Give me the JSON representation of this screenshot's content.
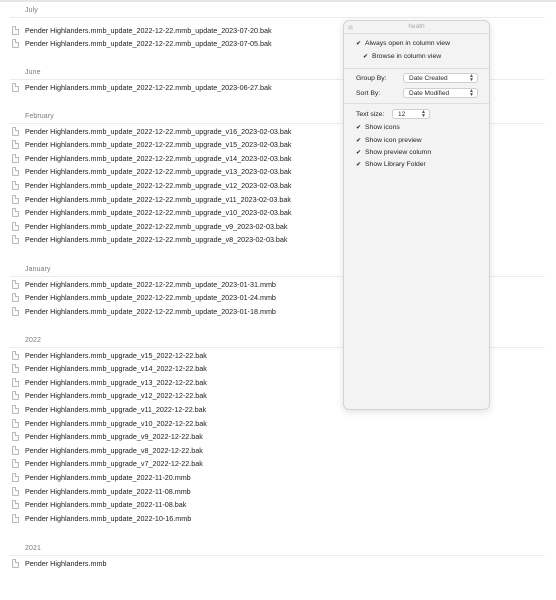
{
  "groups": [
    {
      "header": "July",
      "files": [
        "Pender Highlanders.mmb_update_2022-12-22.mmb_update_2023-07-20.bak",
        "Pender Highlanders.mmb_update_2022-12-22.mmb_update_2023-07-05.bak"
      ]
    },
    {
      "header": "June",
      "files": [
        "Pender Highlanders.mmb_update_2022-12-22.mmb_update_2023-06-27.bak"
      ]
    },
    {
      "header": "February",
      "files": [
        "Pender Highlanders.mmb_update_2022-12-22.mmb_upgrade_v16_2023-02-03.bak",
        "Pender Highlanders.mmb_update_2022-12-22.mmb_upgrade_v15_2023-02-03.bak",
        "Pender Highlanders.mmb_update_2022-12-22.mmb_upgrade_v14_2023-02-03.bak",
        "Pender Highlanders.mmb_update_2022-12-22.mmb_upgrade_v13_2023-02-03.bak",
        "Pender Highlanders.mmb_update_2022-12-22.mmb_upgrade_v12_2023-02-03.bak",
        "Pender Highlanders.mmb_update_2022-12-22.mmb_upgrade_v11_2023-02-03.bak",
        "Pender Highlanders.mmb_update_2022-12-22.mmb_upgrade_v10_2023-02-03.bak",
        "Pender Highlanders.mmb_update_2022-12-22.mmb_upgrade_v9_2023-02-03.bak",
        "Pender Highlanders.mmb_update_2022-12-22.mmb_upgrade_v8_2023-02-03.bak"
      ]
    },
    {
      "header": "January",
      "files": [
        "Pender Highlanders.mmb_update_2022-12-22.mmb_update_2023-01-31.mmb",
        "Pender Highlanders.mmb_update_2022-12-22.mmb_update_2023-01-24.mmb",
        "Pender Highlanders.mmb_update_2022-12-22.mmb_update_2023-01-18.mmb"
      ]
    },
    {
      "header": "2022",
      "files": [
        "Pender Highlanders.mmb_upgrade_v15_2022-12-22.bak",
        "Pender Highlanders.mmb_upgrade_v14_2022-12-22.bak",
        "Pender Highlanders.mmb_upgrade_v13_2022-12-22.bak",
        "Pender Highlanders.mmb_upgrade_v12_2022-12-22.bak",
        "Pender Highlanders.mmb_upgrade_v11_2022-12-22.bak",
        "Pender Highlanders.mmb_upgrade_v10_2022-12-22.bak",
        "Pender Highlanders.mmb_upgrade_v9_2022-12-22.bak",
        "Pender Highlanders.mmb_upgrade_v8_2022-12-22.bak",
        "Pender Highlanders.mmb_upgrade_v7_2022-12-22.bak",
        "Pender Highlanders.mmb_update_2022-11-20.mmb",
        "Pender Highlanders.mmb_update_2022-11-08.mmb",
        "Pender Highlanders.mmb_update_2022-11-08.bak",
        "Pender Highlanders.mmb_update_2022-10-16.mmb"
      ]
    },
    {
      "header": "2021",
      "files": [
        "Pender Highlanders.mmb"
      ]
    }
  ],
  "view_options": {
    "title": "heath",
    "always_open_column_view": {
      "label": "Always open in column view",
      "checked": true
    },
    "browse_column_view": {
      "label": "Browse in column view",
      "checked": true
    },
    "group_by": {
      "label": "Group By:",
      "value": "Date Created"
    },
    "sort_by": {
      "label": "Sort By:",
      "value": "Date Modified"
    },
    "text_size": {
      "label": "Text size:",
      "value": "12"
    },
    "show_icons": {
      "label": "Show icons",
      "checked": true
    },
    "show_icon_preview": {
      "label": "Show icon preview",
      "checked": true
    },
    "show_preview_column": {
      "label": "Show preview column",
      "checked": true
    },
    "show_library_folder": {
      "label": "Show Library Folder",
      "checked": true
    }
  }
}
